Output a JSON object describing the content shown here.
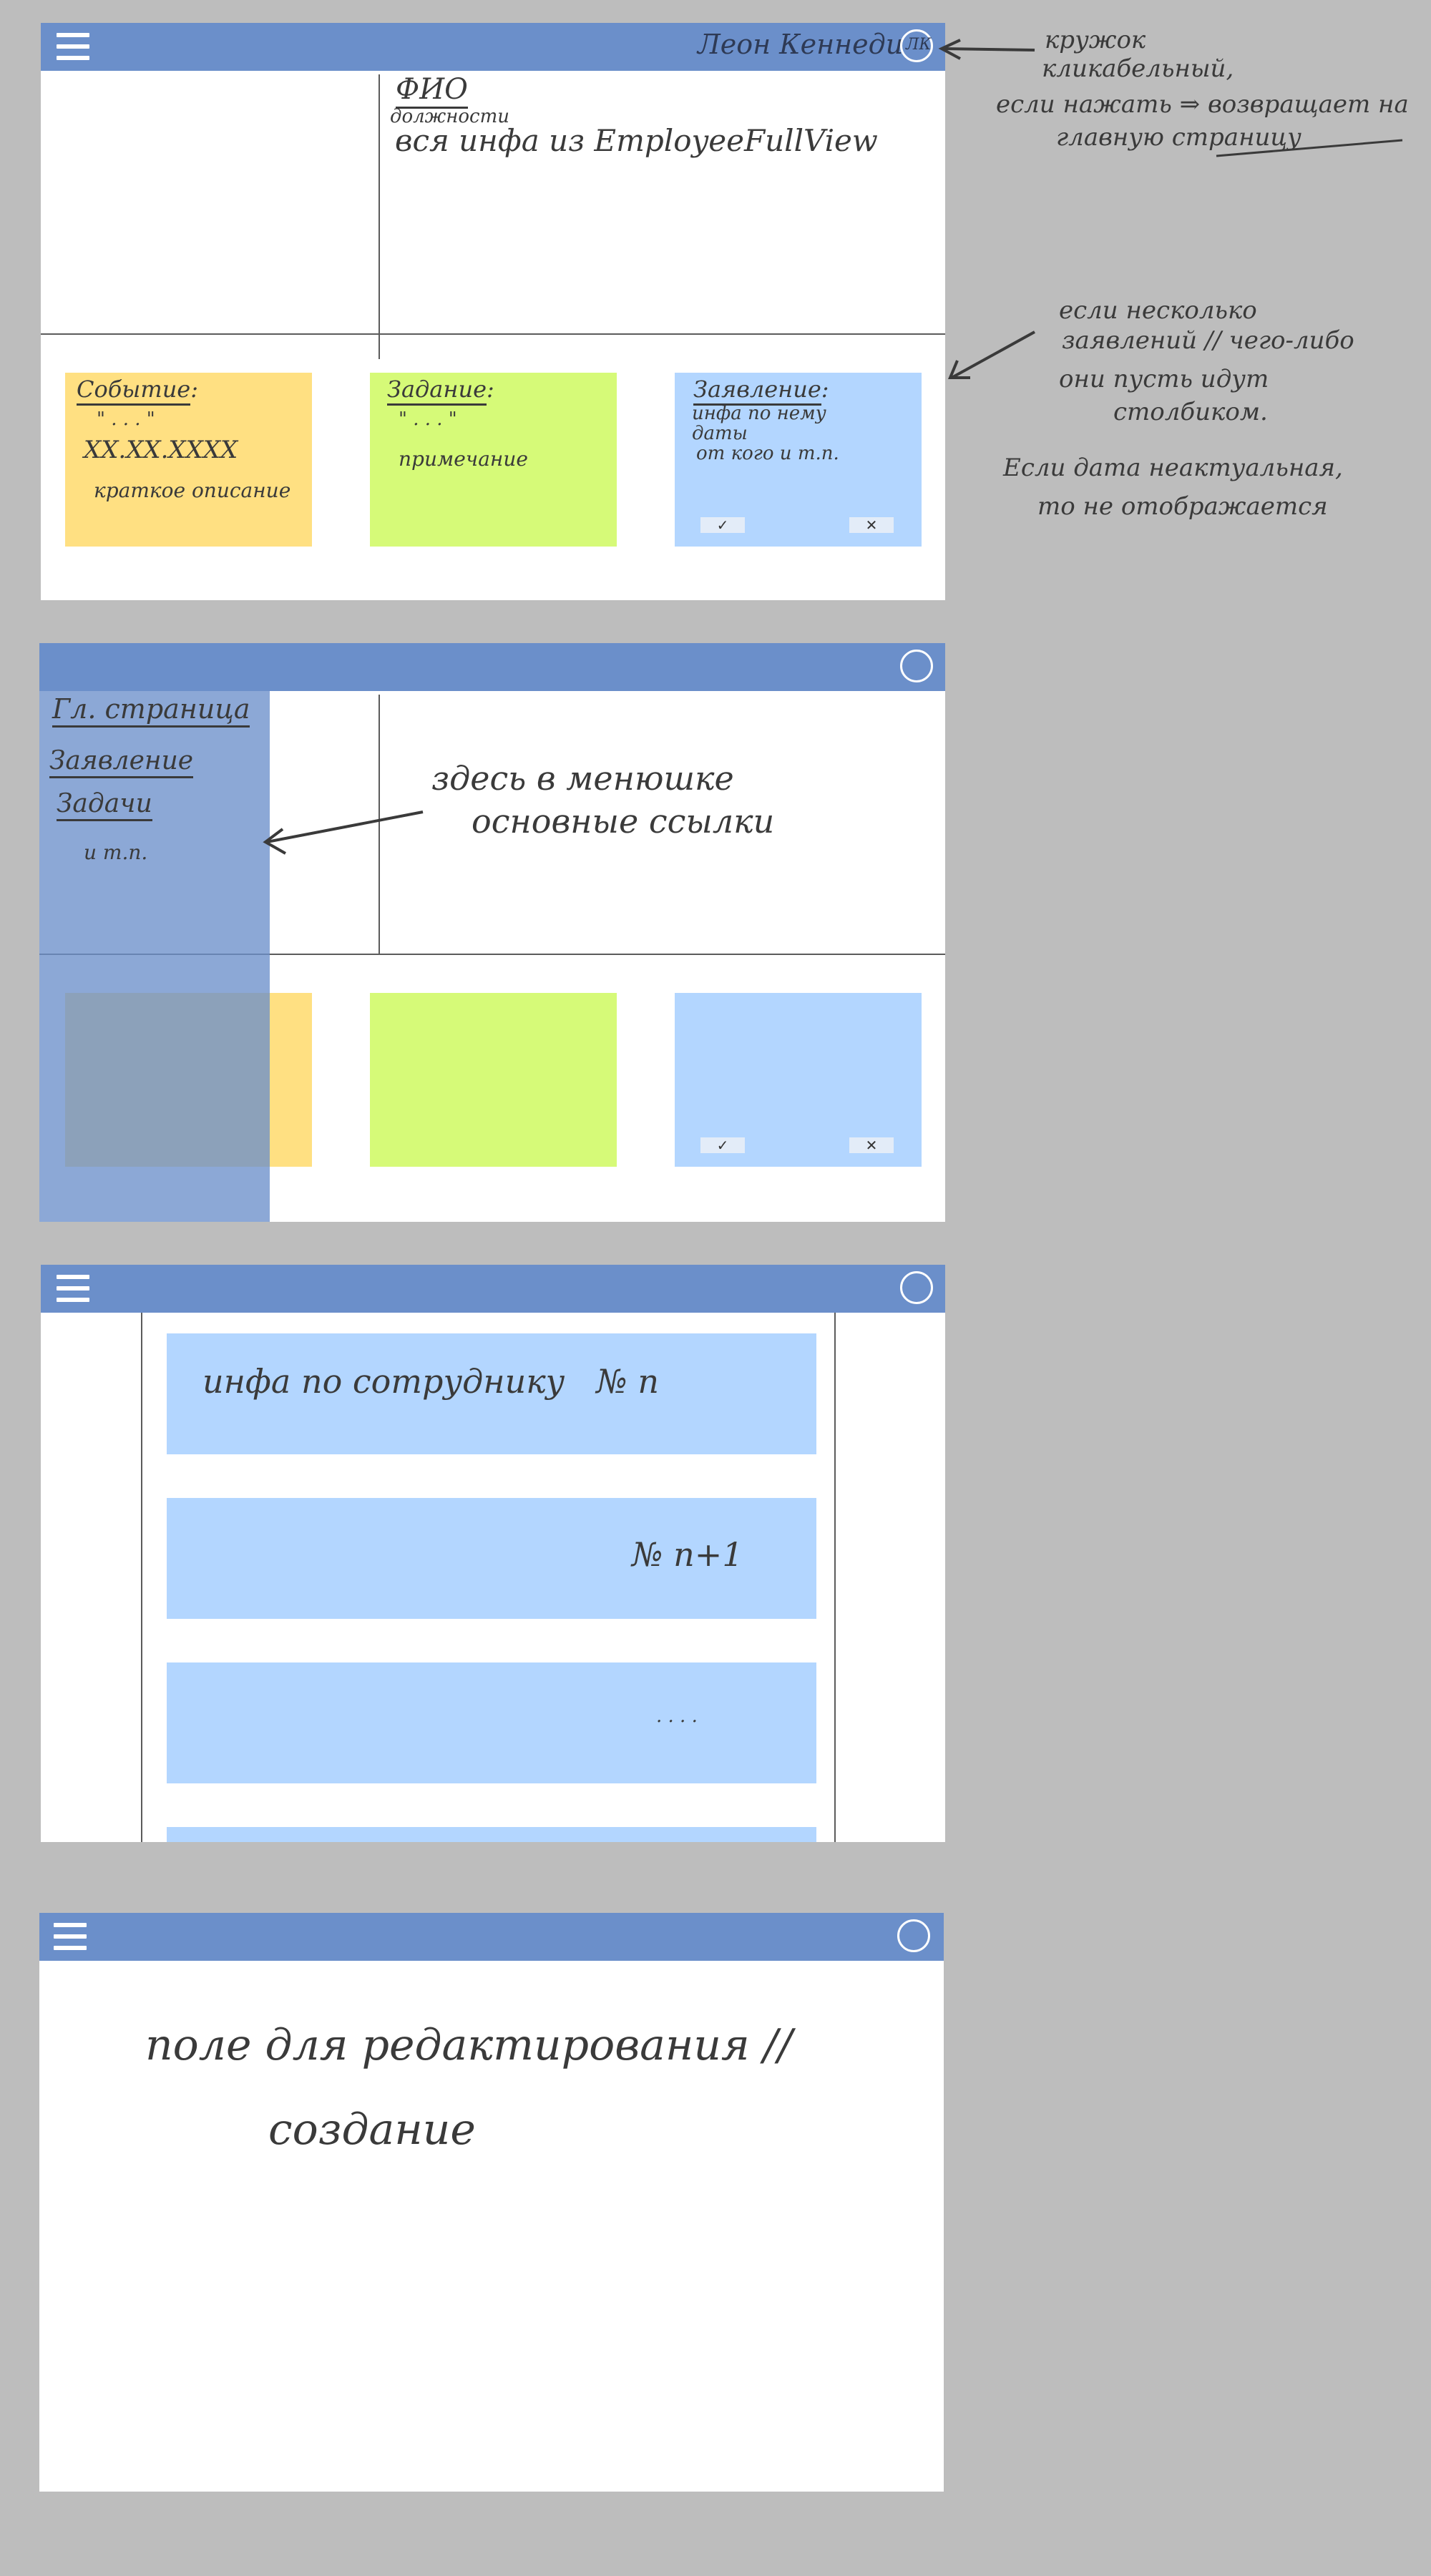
{
  "frame1": {
    "user_name": "Леон Кеннеди",
    "avatar_initials": "ЛК",
    "profile_title": "ФИО",
    "profile_subtitle": "должности",
    "profile_info": "вся инфа из EmployeeFullView",
    "event_card": {
      "title": "Событие",
      "quote": "\" . . . \"",
      "date": "XX.XX.XXXX",
      "description": "краткое описание"
    },
    "task_card": {
      "title": "Задание",
      "quote": "\" . . . \"",
      "note": "примечание"
    },
    "request_card": {
      "title": "Заявление",
      "line1": "инфа по нему",
      "line2": "даты",
      "line3": "от кого и т.п.",
      "accept": "✓",
      "reject": "✕"
    }
  },
  "frame2": {
    "menu_items": [
      "Гл. страница",
      "Заявление",
      "Задачи",
      "и т.п."
    ],
    "note_line1": "здесь в менюшке",
    "note_line2": "основные ссылки",
    "accept": "✓",
    "reject": "✕"
  },
  "frame3": {
    "row1": "инфа по сотруднику   № n",
    "row2": "№ n+1",
    "row3": ". . . ."
  },
  "frame4": {
    "line1": "поле для редактирования //",
    "line2": "создание"
  },
  "annotations": {
    "avatar_line1": "кружок",
    "avatar_line2": "кликабельный,",
    "avatar_line3": "если нажать ⇒ возвращает на",
    "avatar_line4": "главную страницу",
    "cards_line1": "если несколько",
    "cards_line2": "заявлений // чего-либо",
    "cards_line3": "они пусть идут",
    "cards_line4": "столбиком.",
    "cards_line5": "Если дата неактуальная,",
    "cards_line6": "то не отображается"
  },
  "colors": {
    "background": "#bdbdbd",
    "topbar": "#6b8fca",
    "menu_panel": "#6b8fca",
    "yellow_card": "#ffe082",
    "green_card": "#d6fa78",
    "blue_card": "#b3d6ff"
  }
}
